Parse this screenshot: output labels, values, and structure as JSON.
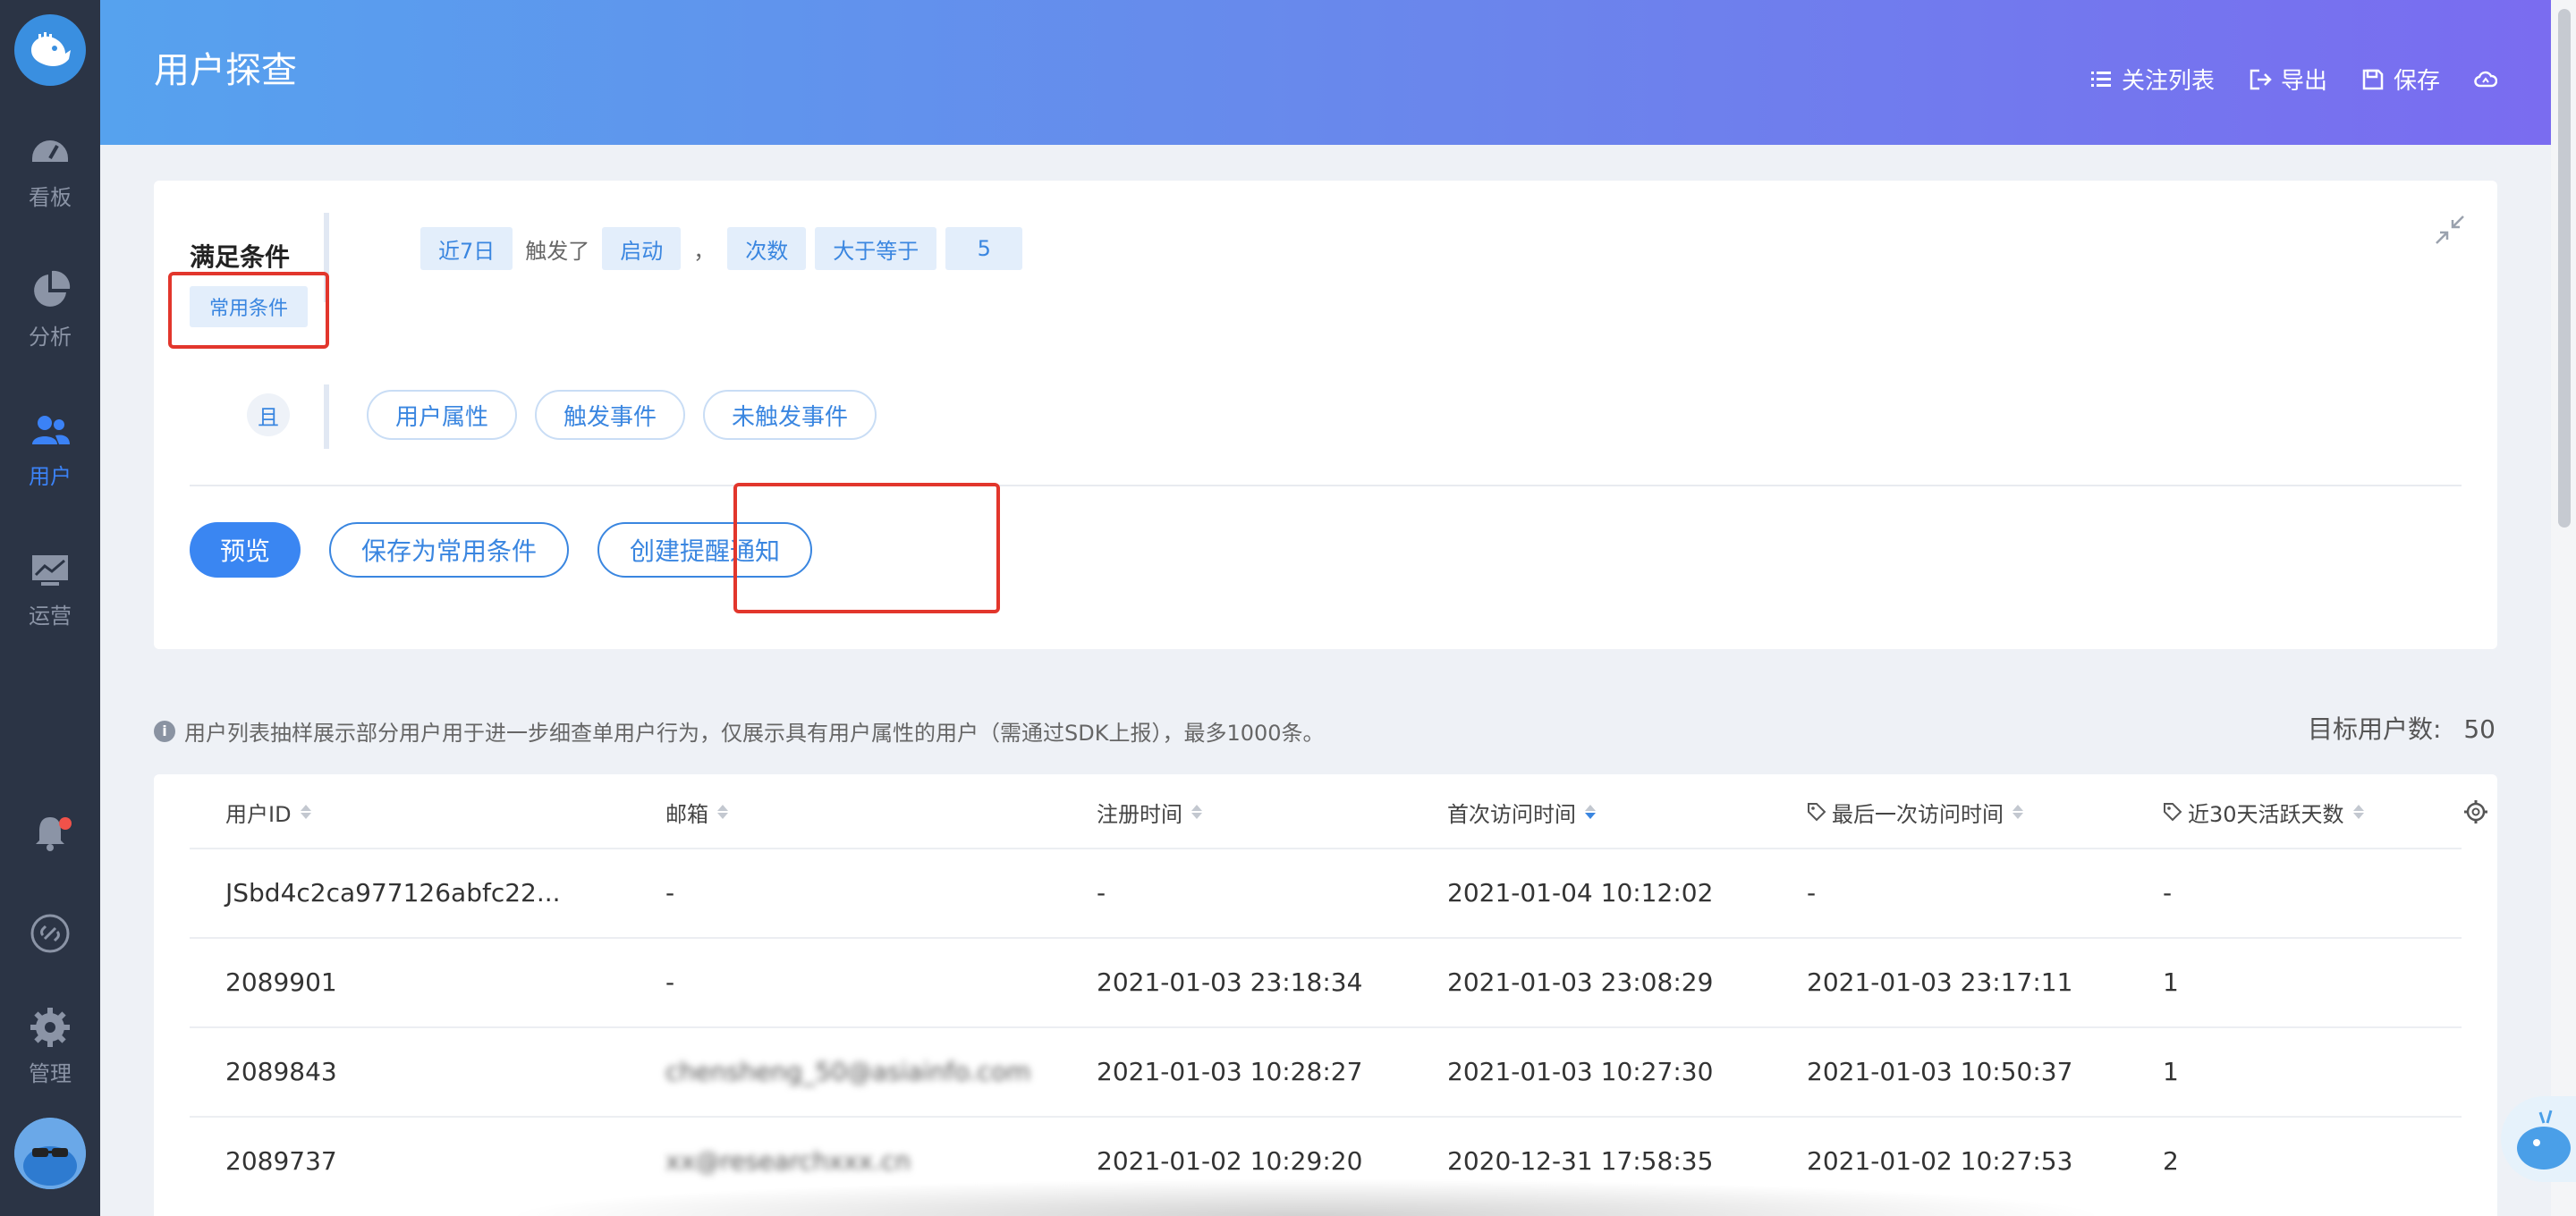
{
  "app": {
    "title": "用户探查"
  },
  "sidebar": {
    "items": [
      {
        "label": "看板",
        "icon": "dashboard-gauge-icon"
      },
      {
        "label": "分析",
        "icon": "pie-chart-icon"
      },
      {
        "label": "用户",
        "icon": "users-icon",
        "active": true
      },
      {
        "label": "运营",
        "icon": "monitor-chart-icon"
      }
    ],
    "bottom": [
      {
        "label": "",
        "icon": "bell-icon"
      },
      {
        "label": "",
        "icon": "link-circle-icon"
      },
      {
        "label": "管理",
        "icon": "gear-icon"
      }
    ]
  },
  "header": {
    "actions": [
      {
        "label": "关注列表",
        "icon": "list-icon"
      },
      {
        "label": "导出",
        "icon": "export-icon"
      },
      {
        "label": "保存",
        "icon": "save-icon"
      },
      {
        "label": "",
        "icon": "cloud-icon"
      }
    ]
  },
  "conditions": {
    "title": "满足条件",
    "common_label": "常用条件",
    "rule": {
      "period": "近7日",
      "verb": "触发了",
      "event": "启动",
      "separator": "，",
      "metric": "次数",
      "operator": "大于等于",
      "value": "5"
    },
    "and_label": "且",
    "add_pills": [
      "用户属性",
      "触发事件",
      "未触发事件"
    ],
    "buttons": {
      "preview": "预览",
      "save_common": "保存为常用条件",
      "create_alert": "创建提醒通知"
    }
  },
  "info": {
    "text": "用户列表抽样展示部分用户用于进一步细查单用户行为，仅展示具有用户属性的用户（需通过SDK上报），最多1000条。",
    "target_label": "目标用户数:",
    "target_value": "50"
  },
  "table": {
    "columns": [
      "用户ID",
      "邮箱",
      "注册时间",
      "首次访问时间",
      "最后一次访问时间",
      "近30天活跃天数"
    ],
    "sorted_column": "首次访问时间",
    "rows": [
      [
        "JSbd4c2ca977126abfc22...",
        "-",
        "-",
        "2021-01-04 10:12:02",
        "-",
        "-"
      ],
      [
        "2089901",
        "-",
        "2021-01-03 23:18:34",
        "2021-01-03 23:08:29",
        "2021-01-03 23:17:11",
        "1"
      ],
      [
        "2089843",
        "chensheng_50@asiainfo.com",
        "2021-01-03 10:28:27",
        "2021-01-03 10:27:30",
        "2021-01-03 10:50:37",
        "1"
      ],
      [
        "2089737",
        "xx@researchxxx.cn",
        "2021-01-02 10:29:20",
        "2020-12-31 17:58:35",
        "2021-01-02 10:27:53",
        "2"
      ]
    ]
  },
  "colors": {
    "sidebar_bg": "#2b3445",
    "accent": "#3a86f2",
    "header_gradient_start": "#56a2ee",
    "header_gradient_end": "#7a6cf0",
    "highlight_border": "#e2362c"
  }
}
